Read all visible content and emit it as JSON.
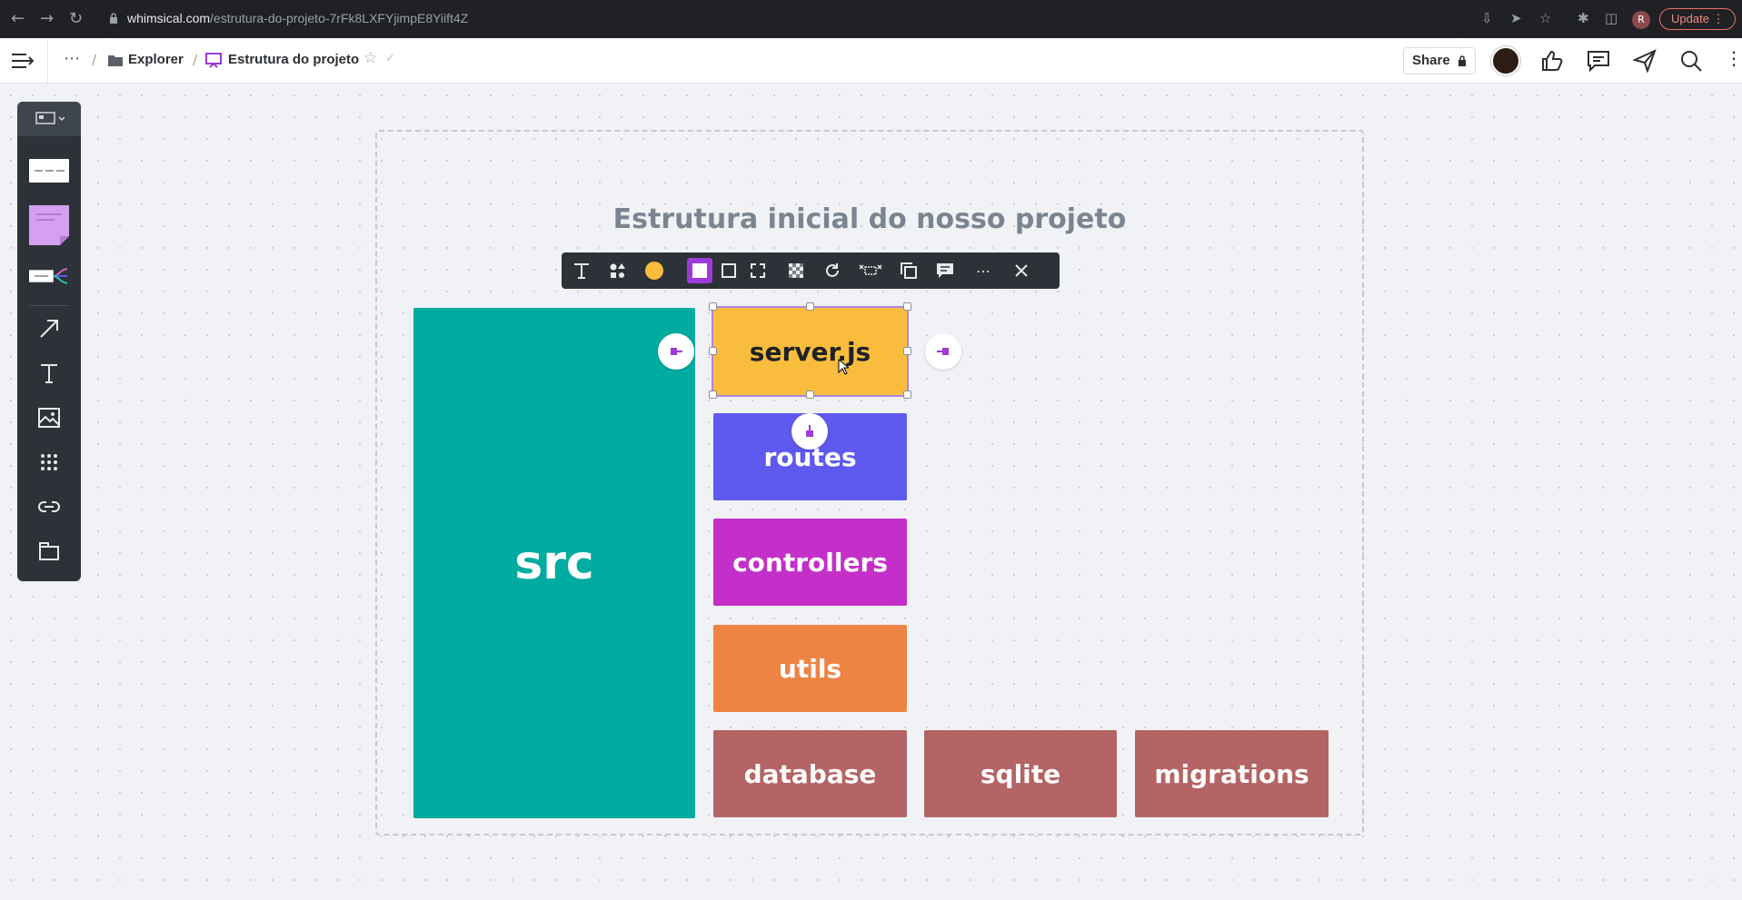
{
  "browser": {
    "url_domain": "whimsical.com",
    "url_path": "/estrutura-do-projeto-7rFk8LXFYjimpE8Yiift4Z",
    "update_label": "Update",
    "profile_initial": "R"
  },
  "header": {
    "breadcrumb_folder": "Explorer",
    "breadcrumb_doc": "Estrutura do projeto",
    "share_label": "Share"
  },
  "board": {
    "title": "Estrutura inicial do nosso projeto",
    "boxes": {
      "src": "src",
      "server": "server.js",
      "routes": "routes",
      "controllers": "controllers",
      "utils": "utils",
      "database": "database",
      "sqlite": "sqlite",
      "migrations": "migrations"
    }
  },
  "colors": {
    "src": "#00ac9f",
    "server": "#f9bc3d",
    "routes": "#5e59ef",
    "controllers": "#c42fca",
    "utils": "#ee8444",
    "database": "#b46464",
    "accent": "#9c3bd8"
  },
  "icons": {
    "toolbar": [
      "board-icon",
      "text-card-icon",
      "sticky-note-icon",
      "mindmap-icon",
      "arrow-icon",
      "text-icon",
      "image-icon",
      "grid-icon",
      "link-icon",
      "container-icon"
    ],
    "context": [
      "text-tool-icon",
      "shape-icon",
      "color-icon",
      "fill-solid-icon",
      "fill-outline-icon",
      "fill-dashed-icon",
      "transparency-icon",
      "rotate-icon",
      "align-icon",
      "duplicate-icon",
      "comment-icon",
      "more-icon",
      "close-icon"
    ]
  }
}
